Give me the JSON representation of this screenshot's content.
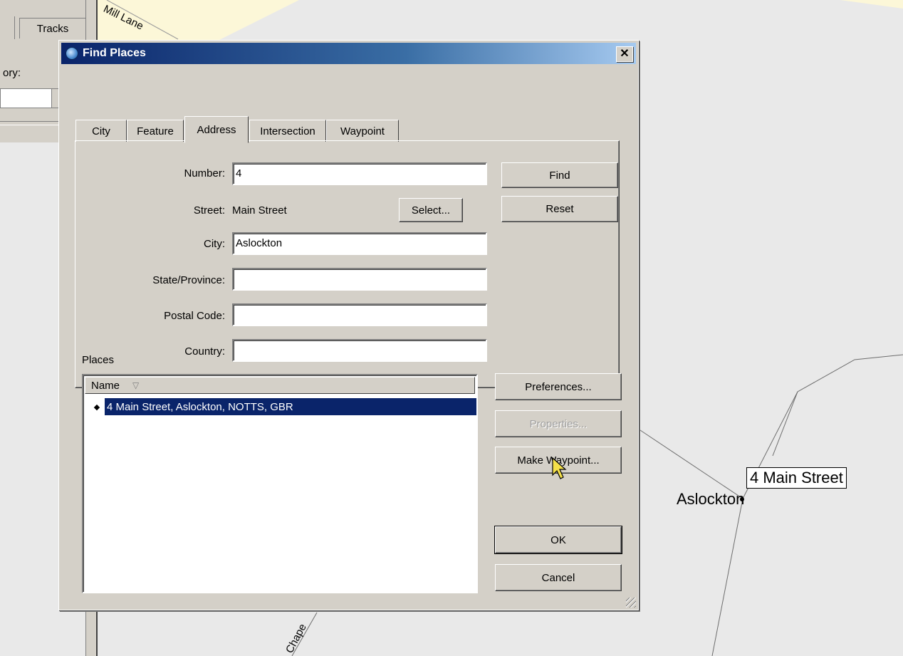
{
  "map": {
    "street_label_top": "Mill Lane",
    "street_label_bottom": "Chape",
    "street_label_partial": "e",
    "town_label": "Aslockton",
    "address_label": "4 Main Street"
  },
  "background_app": {
    "tab_tracks": "Tracks",
    "category_label": "ory:"
  },
  "dialog": {
    "title": "Find Places",
    "close_glyph": "✕",
    "tabs": [
      {
        "label": "City"
      },
      {
        "label": "Feature"
      },
      {
        "label": "Address",
        "active": true
      },
      {
        "label": "Intersection"
      },
      {
        "label": "Waypoint"
      }
    ],
    "fields": {
      "number_label": "Number:",
      "number_value": "4",
      "street_label": "Street:",
      "street_value": "Main Street",
      "select_button": "Select...",
      "city_label": "City:",
      "city_value": "Aslockton",
      "state_label": "State/Province:",
      "state_value": "",
      "postal_label": "Postal Code:",
      "postal_value": "",
      "country_label": "Country:",
      "country_value": ""
    },
    "buttons": {
      "find": "Find",
      "reset": "Reset",
      "preferences": "Preferences...",
      "properties": "Properties...",
      "make_waypoint": "Make Waypoint...",
      "ok": "OK",
      "cancel": "Cancel"
    },
    "places": {
      "label": "Places",
      "column_name": "Name",
      "sort_glyph": "▽",
      "rows": [
        {
          "bullet": "◆",
          "text": "4 Main Street, Aslockton, NOTTS, GBR",
          "selected": true
        }
      ]
    }
  },
  "colors": {
    "title_bar": "#0a246a",
    "selection": "#0a246a",
    "window_face": "#d4d0c8",
    "map_background": "#e9e9e9",
    "map_yellow": "#fcf7d8"
  }
}
